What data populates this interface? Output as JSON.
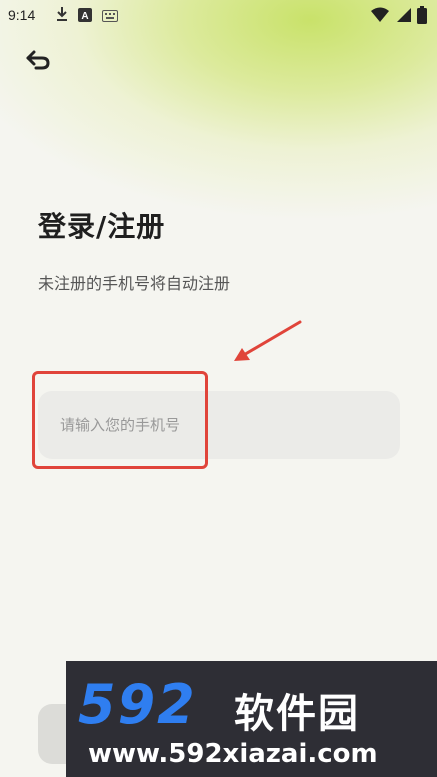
{
  "status_bar": {
    "time": "9:14",
    "left_icons": [
      "download-icon",
      "keyboard-badge-icon",
      "keyboard-icon"
    ],
    "right_icons": [
      "wifi-icon",
      "signal-icon",
      "battery-icon"
    ]
  },
  "header": {
    "back_icon": "back-arrow-icon"
  },
  "login": {
    "title": "登录/注册",
    "subtitle": "未注册的手机号将自动注册",
    "phone_placeholder": "请输入您的手机号",
    "phone_value": ""
  },
  "annotation": {
    "color": "#e0443a"
  },
  "watermark": {
    "logo_number": "592",
    "logo_text": "软件园",
    "url": "www.592xiazai.com"
  },
  "colors": {
    "accent_green": "#c9e26a",
    "background": "#f5f5f0",
    "input_bg": "#ebebe8",
    "watermark_blue": "#2f7ef0"
  }
}
